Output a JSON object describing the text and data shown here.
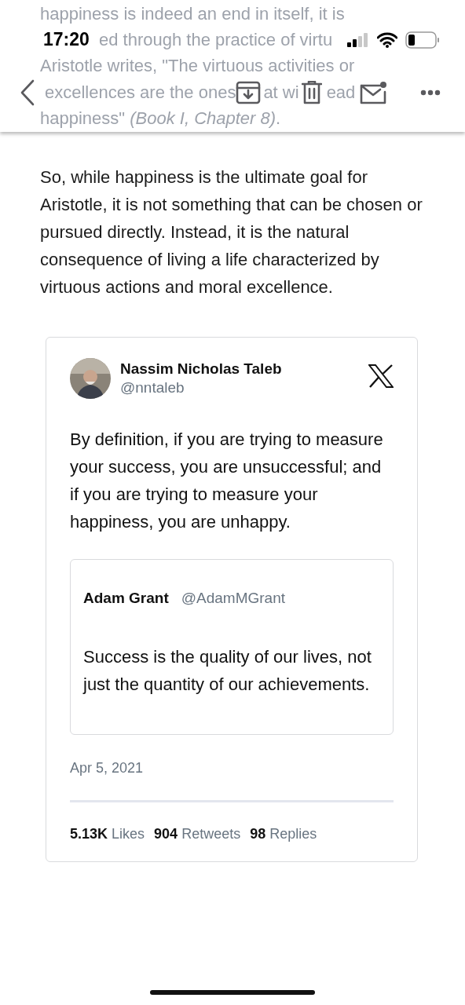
{
  "status_bar": {
    "time": "17:20"
  },
  "faded_lines": [
    {
      "kind": "full",
      "text": "happiness is indeed an end in itself, it is"
    },
    {
      "kind": "status",
      "text": "ed through the practice of virtu"
    },
    {
      "kind": "full",
      "text": "Aristotle writes, \"The virtuous activities or"
    },
    {
      "kind": "toolbar",
      "parts": [
        "excellences are the ones",
        "at wi",
        "ead"
      ]
    },
    {
      "kind": "full",
      "text": "happiness\" *(Book I, Chapter 8)*."
    }
  ],
  "paragraph": "So, while happiness is the ultimate goal for Aristotle, it is not something that can be chosen or pursued directly. Instead, it is the natural consequence of living a life characterized by virtuous actions and moral excellence.",
  "tweet": {
    "author": "Nassim Nicholas Taleb",
    "handle": "@nntaleb",
    "text": "By definition, if you are trying to measure your success, you are unsuccessful; and if you are trying to measure your happiness, you are unhappy.",
    "quoted": {
      "author": "Adam Grant",
      "handle": "@AdamMGrant",
      "text": "Success is the quality of our lives, not just the quantity of our achievements."
    },
    "date": "Apr 5, 2021",
    "stats": [
      {
        "count": "5.13K",
        "label": "Likes"
      },
      {
        "count": "904",
        "label": "Retweets"
      },
      {
        "count": "98",
        "label": "Replies"
      }
    ]
  }
}
